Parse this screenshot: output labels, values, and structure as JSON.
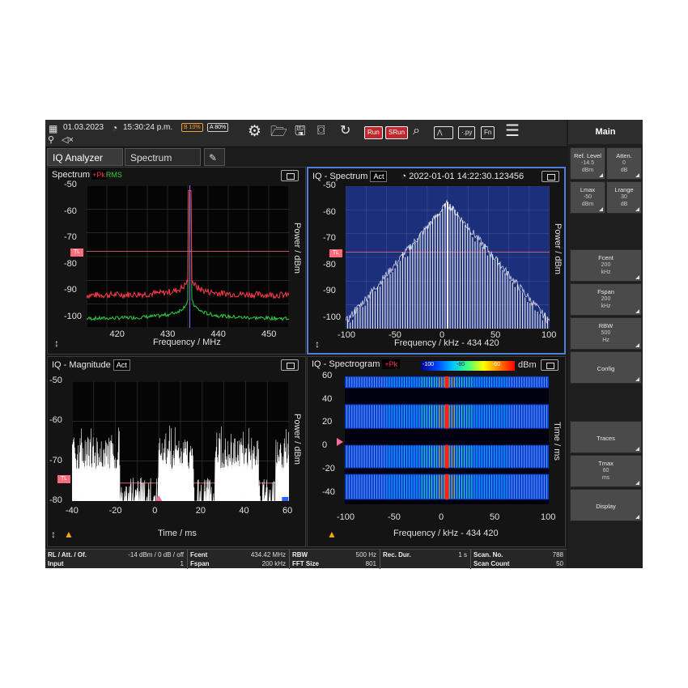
{
  "topbar": {
    "date": "01.03.2023",
    "time": "15:30:24 p.m.",
    "battery_b": "B 10%",
    "battery_a": "A 80%",
    "run_label": "Run",
    "srun_label": "SRun",
    "py_label": "·.py",
    "fn_label": "Fn"
  },
  "tabs": [
    {
      "label": "IQ Analyzer"
    },
    {
      "label": "Spectrum"
    }
  ],
  "panes": {
    "spectrum": {
      "title": "Spectrum",
      "badge_pk": "+Pk",
      "badge_rms": "RMS",
      "yticks": [
        "-50",
        "-60",
        "-70",
        "-80",
        "-90",
        "-100"
      ],
      "xticks": [
        "420",
        "430",
        "440",
        "450"
      ],
      "xlabel": "Frequency / MHz",
      "ylabel": "Power / dBm",
      "tl": "TL"
    },
    "iq_spectrum": {
      "title": "IQ - Spectrum",
      "badge": "Act",
      "timestamp": "2022-01-01 14:22:30.123456",
      "yticks": [
        "-50",
        "-60",
        "-70",
        "-80",
        "-90",
        "-100"
      ],
      "xticks": [
        "-100",
        "-50",
        "0",
        "50",
        "100"
      ],
      "xlabel": "Frequency / kHz - 434 420",
      "ylabel": "Power / dBm",
      "tl": "TL"
    },
    "iq_magnitude": {
      "title": "IQ - Magnitude",
      "badge": "Act",
      "yticks": [
        "-50",
        "-60",
        "-70",
        "-80"
      ],
      "xticks": [
        "-40",
        "-20",
        "0",
        "20",
        "40",
        "60"
      ],
      "xlabel": "Time / ms",
      "ylabel": "Power / dBm",
      "tl": "TL"
    },
    "iq_spectrogram": {
      "title": "IQ - Spectrogram",
      "badge_pk": "+Pk",
      "cbar_labels": [
        "-100",
        "-80",
        "-60"
      ],
      "cbar_unit": "dBm",
      "yticks": [
        "60",
        "40",
        "20",
        "0",
        "-20",
        "-40"
      ],
      "xticks": [
        "-100",
        "-50",
        "0",
        "50",
        "100"
      ],
      "xlabel": "Frequency / kHz - 434 420",
      "ylabel": "Time / ms"
    }
  },
  "status": {
    "rl_label": "RL / Att. / Of.",
    "rl_value": "-14 dBm / 0 dB / off",
    "input_label": "Input",
    "input_value": "1",
    "fcent_label": "Fcent",
    "fcent_value": "434.42 MHz",
    "fspan_label": "Fspan",
    "fspan_value": "200 kHz",
    "rbw_label": "RBW",
    "rbw_value": "500 Hz",
    "fft_label": "FFT Size",
    "fft_value": "801",
    "recdur_label": "Rec. Dur.",
    "recdur_value": "1 s",
    "scanno_label": "Scan. No.",
    "scanno_value": "788",
    "scancount_label": "Scan Count",
    "scancount_value": "50"
  },
  "softkeys": {
    "header": "Main",
    "ref_level": {
      "label": "Ref. Level",
      "value": "-14.5",
      "unit": "dBm"
    },
    "atten": {
      "label": "Atten.",
      "value": "0",
      "unit": "dB"
    },
    "lmax": {
      "label": "Lmax",
      "value": "-50",
      "unit": "dBm"
    },
    "lrange": {
      "label": "Lrange",
      "value": "30",
      "unit": "dB"
    },
    "fcent": {
      "label": "Fcent",
      "value": "200",
      "unit": "kHz"
    },
    "fspan": {
      "label": "Fspan",
      "value": "200",
      "unit": "kHz"
    },
    "rbw": {
      "label": "RBW",
      "value": "500",
      "unit": "Hz"
    },
    "config": {
      "label": "Config"
    },
    "traces": {
      "label": "Traces"
    },
    "tmax": {
      "label": "Tmax",
      "value": "60",
      "unit": "ms"
    },
    "display": {
      "label": "Display"
    }
  },
  "colors": {
    "pk_trace": "#ff3a4a",
    "rms_trace": "#2ecc40",
    "marker_line": "#8a6fff",
    "iq_bg": "#1c2f7a",
    "tl_line": "#ff6b7a",
    "selected_border": "#4d7fd6"
  }
}
